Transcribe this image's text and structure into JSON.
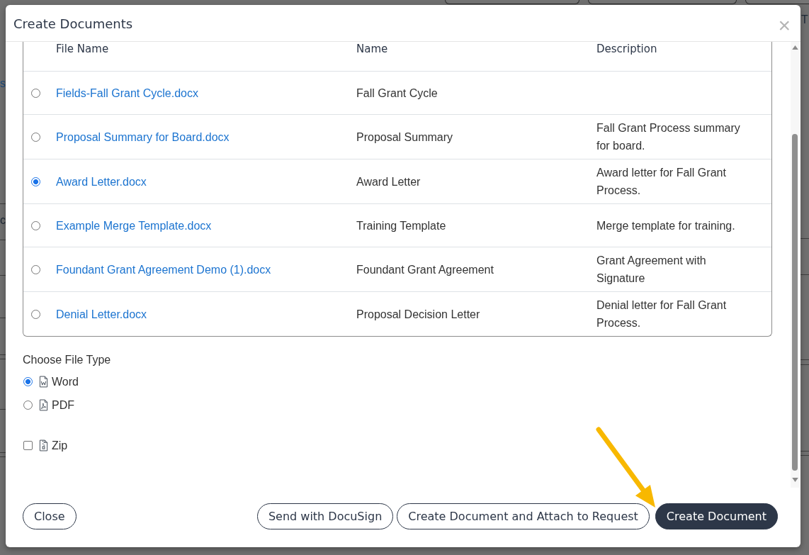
{
  "background_page": {
    "texts": [
      {
        "text": "s",
        "kind": "link"
      },
      {
        "text": "c",
        "kind": "plain"
      },
      {
        "text": "T",
        "kind": "plain"
      }
    ]
  },
  "dialog": {
    "title": "Create Documents",
    "close_symbol": "×",
    "table": {
      "columns": [
        "File Name",
        "Name",
        "Description"
      ],
      "rows": [
        {
          "file_name": "Fields-Fall Grant Cycle.docx",
          "name": "Fall Grant Cycle",
          "selected": false
        },
        {
          "file_name": "Proposal Summary for Board.docx",
          "name": "Proposal Summary",
          "description": "Fall Grant Process summary for board.",
          "selected": false
        },
        {
          "file_name": "Award Letter.docx",
          "name": "Award Letter",
          "description": "Award letter for Fall Grant Process.",
          "selected": true
        },
        {
          "file_name": "Example Merge Template.docx",
          "name": "Training Template",
          "description": "Merge template for training.",
          "selected": false
        },
        {
          "file_name": "Foundant Grant Agreement Demo (1).docx",
          "name": "Foundant Grant Agreement",
          "description": "Grant Agreement with Signature",
          "selected": false
        },
        {
          "file_name": "Denial Letter.docx",
          "name": "Proposal Decision Letter",
          "description": "Denial letter for Fall Grant Process.",
          "selected": false
        }
      ]
    },
    "file_type": {
      "label": "Choose File Type",
      "options": [
        {
          "label": "Word",
          "selected": true
        },
        {
          "label": "PDF",
          "selected": false
        }
      ]
    },
    "zip": {
      "label": "Zip",
      "checked": false
    },
    "footer": {
      "left_buttons": [
        {
          "label": "Close",
          "primary": false
        }
      ],
      "right_buttons": [
        {
          "label": "Send with DocuSign",
          "primary": false
        },
        {
          "label": "Create Document and Attach to Request",
          "primary": false
        },
        {
          "label": "Create Document",
          "primary": true
        }
      ]
    }
  }
}
